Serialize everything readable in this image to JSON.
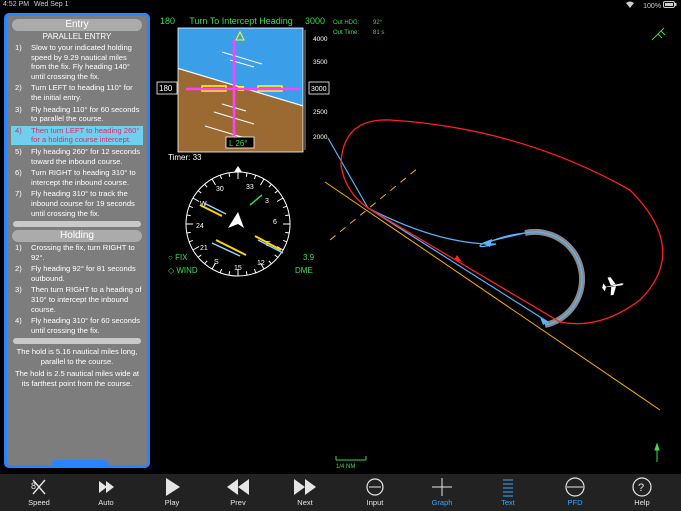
{
  "status_bar": {
    "time": "4:52 PM",
    "date": "Wed Sep 1",
    "battery": "100%"
  },
  "entry": {
    "title": "Entry",
    "entry_type": "PARALLEL ENTRY",
    "steps": [
      {
        "num": "1)",
        "text": "Slow to your indicated holding speed by 9.29 nautical miles from the fix. Fly heading 140° until crossing the fix."
      },
      {
        "num": "2)",
        "text": "Turn LEFT to heading 110° for the initial entry."
      },
      {
        "num": "3)",
        "text": "Fly heading 110° for 60 seconds to parallel the course."
      },
      {
        "num": "4)",
        "text": "Then turn LEFT to heading 260° for a holding course intercept."
      },
      {
        "num": "5)",
        "text": "Fly heading 260° for 12 seconds toward the inbound course."
      },
      {
        "num": "6)",
        "text": "Turn RIGHT to heading 310° to intercept the inbound course."
      },
      {
        "num": "7)",
        "text": "Fly heading 310° to track the inbound course for 19 seconds until crossing the fix."
      }
    ]
  },
  "holding": {
    "title": "Holding",
    "steps": [
      {
        "num": "1)",
        "text": "Crossing the fix, turn RIGHT to 92°."
      },
      {
        "num": "2)",
        "text": "Fly heading 92° for 81 seconds outbound."
      },
      {
        "num": "3)",
        "text": "Then turn RIGHT to a heading of 310° to intercept the inbound course."
      },
      {
        "num": "4)",
        "text": "Fly heading 310° for 60 seconds until crossing the fix."
      }
    ],
    "notes": [
      "The hold is 5.16 nautical miles long, parallel to the course.",
      "The hold is 2.5 nautical miles wide at its farthest point from the course."
    ]
  },
  "pfd": {
    "heading_left": "180",
    "title": "Turn To Intercept Heading",
    "altitude_top": "3000",
    "speed_box": "180",
    "alt_box": "3000",
    "heading_box": "L 26°",
    "timer": "Timer: 33",
    "alt_tape_labels": [
      "4000",
      "3500",
      "3000",
      "2500",
      "2000"
    ]
  },
  "hsi": {
    "compass_labels": [
      "33",
      "3",
      "6",
      "E",
      "12",
      "15",
      "S",
      "21",
      "24",
      "W",
      "30"
    ],
    "fix_label": "FIX",
    "wind_label": "WIND",
    "dme_value": "3.9",
    "dme_label": "DME"
  },
  "out_info": {
    "hdg_label": "Out HDG:",
    "hdg_value": "92°",
    "time_label": "Out Time:",
    "time_value": "81 s"
  },
  "map": {
    "scale_label": "1/4 NM"
  },
  "toolbar": {
    "buttons": [
      {
        "label": "Speed",
        "icon": "speed-icon"
      },
      {
        "label": "Auto",
        "icon": "auto-icon"
      },
      {
        "label": "Play",
        "icon": "play-icon"
      },
      {
        "label": "Prev",
        "icon": "prev-icon"
      },
      {
        "label": "Next",
        "icon": "next-icon"
      },
      {
        "label": "Input",
        "icon": "input-icon"
      },
      {
        "label": "Graph",
        "icon": "graph-icon"
      },
      {
        "label": "Text",
        "icon": "text-icon"
      },
      {
        "label": "PFD",
        "icon": "pfd-icon"
      },
      {
        "label": "Help",
        "icon": "help-icon"
      }
    ]
  },
  "colors": {
    "accent": "#2a84ff",
    "panel": "#7d7d7d",
    "entry_track": "#ff2020",
    "hold_track": "#5ab4ff",
    "course": "#ffb000",
    "pfd_text": "#3ddc54"
  }
}
